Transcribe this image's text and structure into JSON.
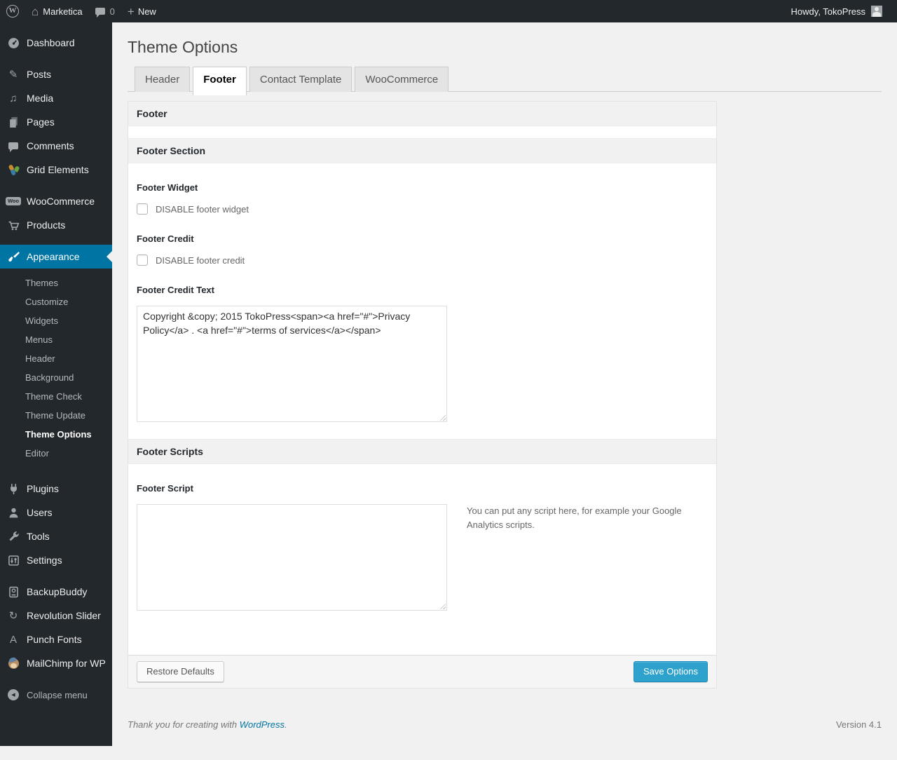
{
  "admin_bar": {
    "site_name": "Marketica",
    "comment_count": "0",
    "new_label": "New",
    "howdy": "Howdy, TokoPress"
  },
  "page": {
    "title": "Theme Options"
  },
  "tabs": [
    {
      "label": "Header",
      "active": false
    },
    {
      "label": "Footer",
      "active": true
    },
    {
      "label": "Contact Template",
      "active": false
    },
    {
      "label": "WooCommerce",
      "active": false
    }
  ],
  "panel": {
    "header": "Footer",
    "section_footer": "Footer Section",
    "footer_widget": {
      "label": "Footer Widget",
      "checkbox_label": "DISABLE footer widget",
      "checked": false
    },
    "footer_credit": {
      "label": "Footer Credit",
      "checkbox_label": "DISABLE footer credit",
      "checked": false
    },
    "footer_credit_text": {
      "label": "Footer Credit Text",
      "value": "Copyright &copy; 2015 TokoPress<span><a href=\"#\">Privacy Policy</a> . <a href=\"#\">terms of services</a></span>"
    },
    "section_scripts": "Footer Scripts",
    "footer_script": {
      "label": "Footer Script",
      "value": "",
      "help": "You can put any script here, for example your Google Analytics scripts."
    },
    "buttons": {
      "restore": "Restore Defaults",
      "save": "Save Options"
    }
  },
  "sidebar": {
    "groups": [
      {
        "items": [
          {
            "name": "dashboard",
            "icon": "dashboard-icon",
            "label": "Dashboard"
          }
        ]
      },
      {
        "items": [
          {
            "name": "posts",
            "icon": "posts-icon",
            "label": "Posts"
          },
          {
            "name": "media",
            "icon": "media-icon",
            "label": "Media"
          },
          {
            "name": "pages",
            "icon": "pages-icon",
            "label": "Pages"
          },
          {
            "name": "comments",
            "icon": "comments-icon",
            "label": "Comments"
          },
          {
            "name": "grid-elements",
            "icon": "grid-elements-icon",
            "label": "Grid Elements"
          }
        ]
      },
      {
        "items": [
          {
            "name": "woocommerce",
            "icon": "woocommerce-icon",
            "label": "WooCommerce"
          },
          {
            "name": "products",
            "icon": "products-icon",
            "label": "Products"
          }
        ]
      },
      {
        "items": [
          {
            "name": "appearance",
            "icon": "appearance-icon",
            "label": "Appearance",
            "active": true,
            "submenu": [
              {
                "label": "Themes"
              },
              {
                "label": "Customize"
              },
              {
                "label": "Widgets"
              },
              {
                "label": "Menus"
              },
              {
                "label": "Header"
              },
              {
                "label": "Background"
              },
              {
                "label": "Theme Check"
              },
              {
                "label": "Theme Update"
              },
              {
                "label": "Theme Options",
                "current": true
              },
              {
                "label": "Editor"
              }
            ]
          }
        ]
      },
      {
        "items": [
          {
            "name": "plugins",
            "icon": "plugins-icon",
            "label": "Plugins"
          },
          {
            "name": "users",
            "icon": "users-icon",
            "label": "Users"
          },
          {
            "name": "tools",
            "icon": "tools-icon",
            "label": "Tools"
          },
          {
            "name": "settings",
            "icon": "settings-icon",
            "label": "Settings"
          }
        ]
      },
      {
        "items": [
          {
            "name": "backupbuddy",
            "icon": "backupbuddy-icon",
            "label": "BackupBuddy"
          },
          {
            "name": "revolution-slider",
            "icon": "revolution-slider-icon",
            "label": "Revolution Slider"
          },
          {
            "name": "punch-fonts",
            "icon": "punch-fonts-icon",
            "label": "Punch Fonts"
          },
          {
            "name": "mailchimp-for-wp",
            "icon": "mailchimp-icon",
            "label": "MailChimp for WP"
          }
        ]
      },
      {
        "items": [
          {
            "name": "collapse-menu",
            "icon": "collapse-icon",
            "label": "Collapse menu",
            "dim": true
          }
        ]
      }
    ]
  },
  "footer": {
    "thanks_prefix": "Thank you for creating with ",
    "wordpress_link": "WordPress",
    "thanks_suffix": ".",
    "version": "Version 4.1"
  },
  "colors": {
    "accent": "#0074a2",
    "primary_button": "#2ea2cc",
    "admin_bg": "#23282d"
  }
}
